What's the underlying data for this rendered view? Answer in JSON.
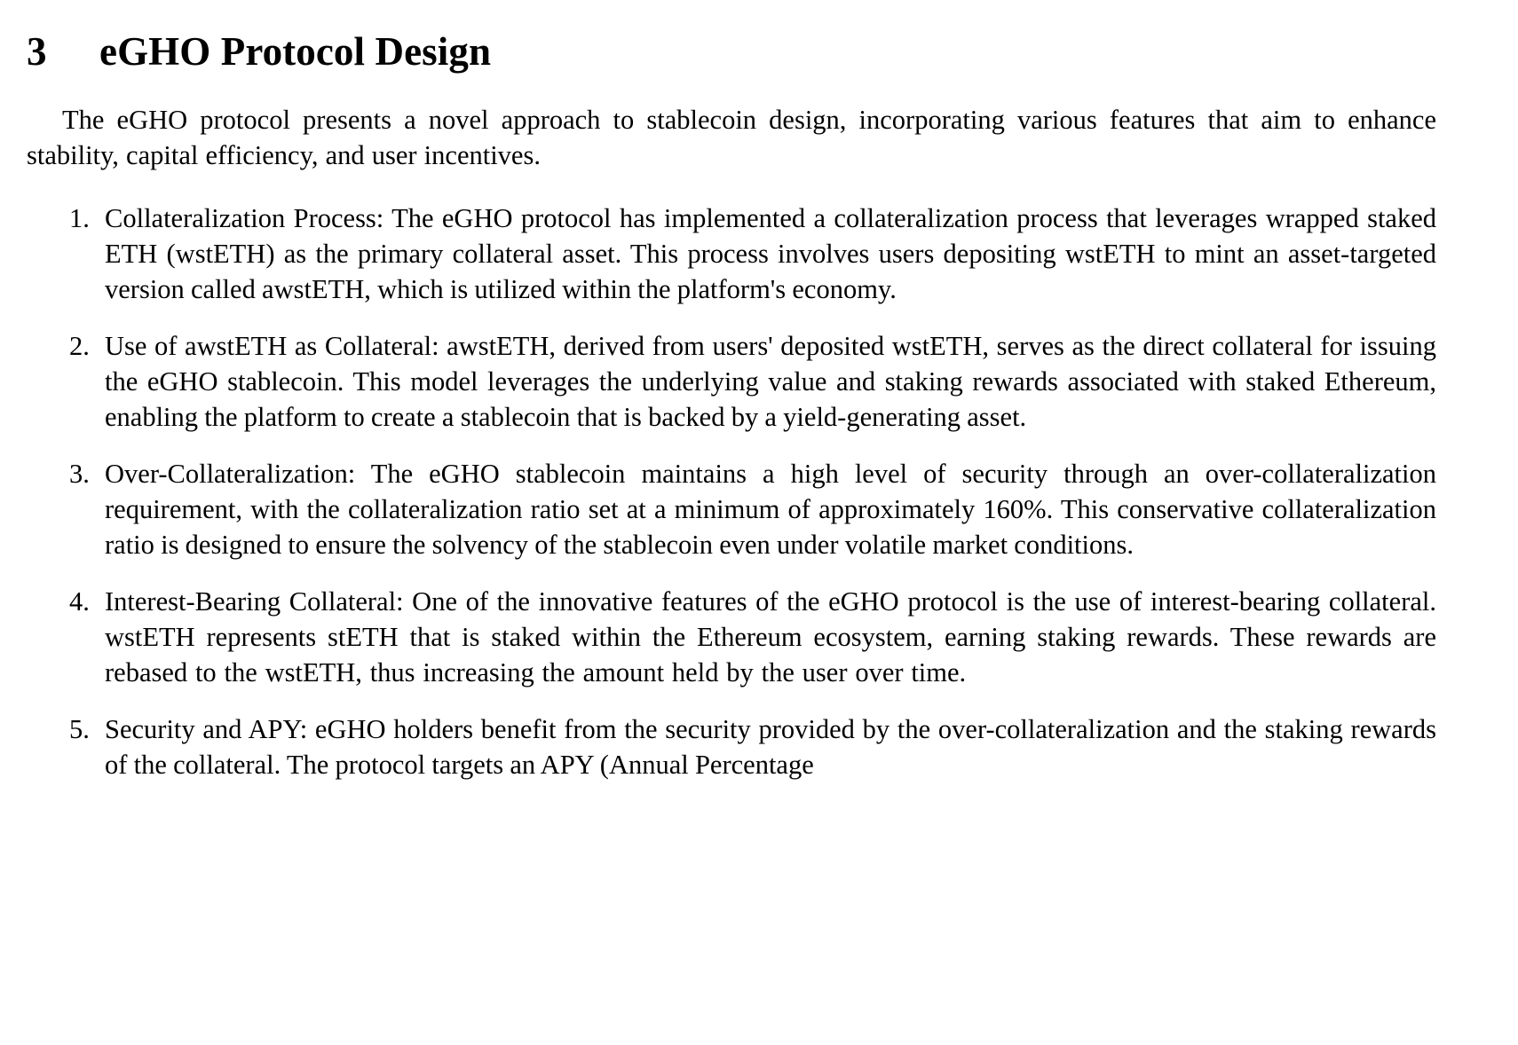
{
  "document": {
    "heading": {
      "number": "3",
      "title": "eGHO Protocol Design"
    },
    "intro_paragraph": "The eGHO protocol presents a novel approach to stablecoin design, incorporating various features that aim to enhance stability, capital efficiency, and user incentives.",
    "list": {
      "type": "ordered-numeric",
      "items": [
        {
          "marker": "1.",
          "text": "Collateralization Process: The eGHO protocol has implemented a collateralization process that leverages wrapped staked ETH (wstETH) as the primary collateral asset. This process involves users depositing wstETH to mint an asset-targeted version called awstETH, which is utilized within the platform's economy."
        },
        {
          "marker": "2.",
          "text": "Use of awstETH as Collateral: awstETH, derived from users' deposited wstETH, serves as the direct collateral for issuing the eGHO stablecoin. This model leverages the underlying value and staking rewards associated with staked Ethereum, enabling the platform to create a stablecoin that is backed by a yield-generating asset."
        },
        {
          "marker": "3.",
          "text": "Over-Collateralization: The eGHO stablecoin maintains a high level of security through an over-collateralization requirement, with the collateralization ratio set at a minimum of approximately 160%. This conservative collateralization ratio is designed to ensure the solvency of the stablecoin even under volatile market conditions."
        },
        {
          "marker": "4.",
          "text": "Interest-Bearing Collateral: One of the innovative features of the eGHO protocol is the use of interest-bearing collateral. wstETH represents stETH that is staked within the Ethereum ecosystem, earning staking rewards. These rewards are rebased to the wstETH, thus increasing the amount held by the user over time."
        },
        {
          "marker": "5.",
          "text": "Security and APY: eGHO holders benefit from the security provided by the over-collateralization and the staking rewards of the collateral. The protocol targets an APY (Annual Percentage"
        }
      ]
    }
  },
  "style": {
    "text_color": "#000000",
    "page_background": "#ffffff"
  }
}
